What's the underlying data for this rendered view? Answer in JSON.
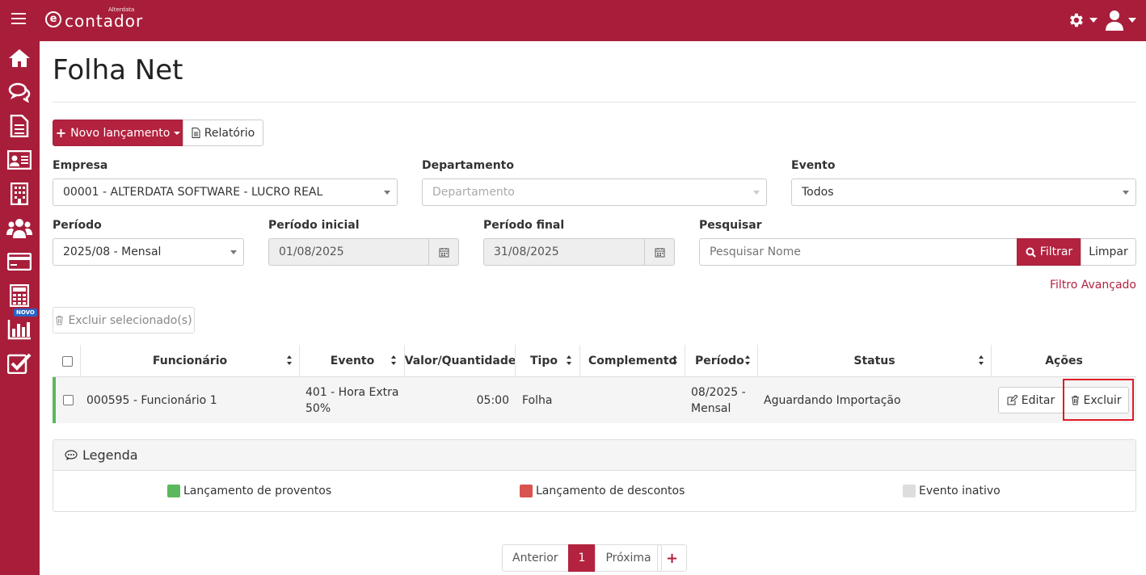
{
  "header": {
    "logo_super": "Alterdata",
    "logo_text": "contador",
    "logo_mark": "e"
  },
  "sidebar": {
    "items": [
      {
        "icon": "home-icon"
      },
      {
        "icon": "chat-icon"
      },
      {
        "icon": "document-icon"
      },
      {
        "icon": "id-card-icon"
      },
      {
        "icon": "building-icon"
      },
      {
        "icon": "users-icon"
      },
      {
        "icon": "credit-card-icon"
      },
      {
        "icon": "calculator-icon"
      },
      {
        "icon": "bar-chart-icon"
      },
      {
        "icon": "checkbox-icon"
      }
    ],
    "novo_badge": "NOVO"
  },
  "page": {
    "title": "Folha Net"
  },
  "toolbar": {
    "new_entry_label": "Novo lançamento",
    "report_label": "Relatório"
  },
  "filters": {
    "empresa_label": "Empresa",
    "empresa_value": "00001 - ALTERDATA SOFTWARE - LUCRO REAL",
    "departamento_label": "Departamento",
    "departamento_placeholder": "Departamento",
    "evento_label": "Evento",
    "evento_value": "Todos",
    "periodo_label": "Período",
    "periodo_value": "2025/08 - Mensal",
    "periodo_inicial_label": "Período inicial",
    "periodo_inicial_value": "01/08/2025",
    "periodo_final_label": "Período final",
    "periodo_final_value": "31/08/2025",
    "pesquisar_label": "Pesquisar",
    "pesquisar_placeholder": "Pesquisar Nome",
    "filter_button": "Filtrar",
    "clear_button": "Limpar",
    "advanced_link": "Filtro Avançado"
  },
  "bulk": {
    "delete_selected_label": "Excluir selecionado(s)"
  },
  "table": {
    "columns": [
      "Funcionário",
      "Evento",
      "Valor/Quantidade",
      "Tipo",
      "Complemento",
      "Período",
      "Status",
      "Ações"
    ],
    "rows": [
      {
        "funcionario": "000595 - Funcionário 1",
        "evento_line1": "401 - Hora Extra",
        "evento_line2": "50%",
        "valor": "05:00",
        "tipo": "Folha",
        "complemento": "",
        "periodo_line1": "08/2025 -",
        "periodo_line2": "Mensal",
        "status": "Aguardando Importação",
        "edit_label": "Editar",
        "delete_label": "Excluir",
        "row_color": "#5cb85c"
      }
    ]
  },
  "legend": {
    "title": "Legenda",
    "items": [
      {
        "label": "Lançamento de proventos",
        "color": "#5cb85c"
      },
      {
        "label": "Lançamento de descontos",
        "color": "#d9534f"
      },
      {
        "label": "Evento inativo",
        "color": "#dddddd"
      }
    ]
  },
  "pagination": {
    "prev": "Anterior",
    "current": "1",
    "next": "Próxima",
    "add": "+"
  },
  "colors": {
    "brand": "#a81e3a",
    "accent": "#b3223f"
  }
}
